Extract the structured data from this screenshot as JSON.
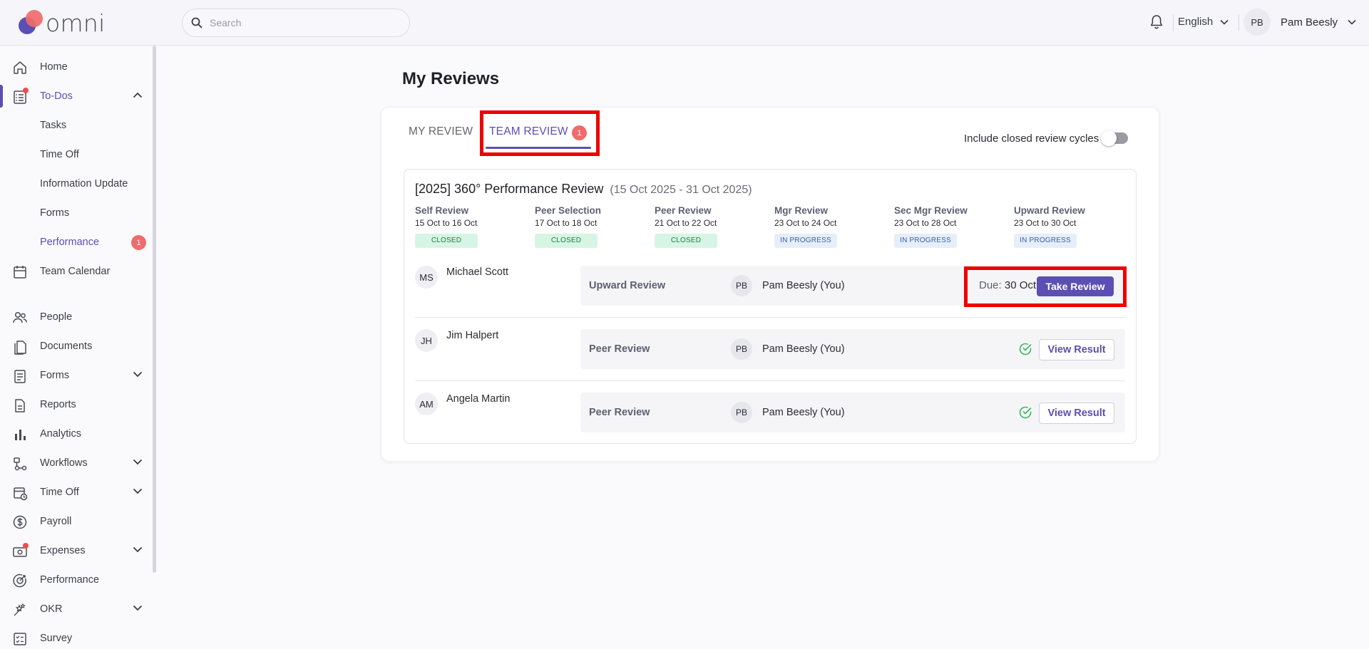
{
  "header": {
    "logo_text": "omni",
    "search_placeholder": "Search",
    "language": "English",
    "user_initials": "PB",
    "user_name": "Pam Beesly"
  },
  "sidebar": {
    "items": [
      {
        "label": "Home",
        "icon": "home-icon"
      },
      {
        "label": "To-Dos",
        "icon": "todo-list-icon"
      },
      {
        "label": "Team Calendar",
        "icon": "calendar-icon"
      },
      {
        "label": "People",
        "icon": "people-icon"
      },
      {
        "label": "Documents",
        "icon": "documents-icon"
      },
      {
        "label": "Forms",
        "icon": "forms-icon"
      },
      {
        "label": "Reports",
        "icon": "report-icon"
      },
      {
        "label": "Analytics",
        "icon": "bar-chart-icon"
      },
      {
        "label": "Workflows",
        "icon": "workflow-icon"
      },
      {
        "label": "Time Off",
        "icon": "time-off-icon"
      },
      {
        "label": "Payroll",
        "icon": "dollar-icon"
      },
      {
        "label": "Expenses",
        "icon": "expenses-icon"
      },
      {
        "label": "Performance",
        "icon": "performance-icon"
      },
      {
        "label": "OKR",
        "icon": "okr-icon"
      },
      {
        "label": "Survey",
        "icon": "survey-icon"
      }
    ],
    "todo_sub": [
      {
        "label": "Tasks"
      },
      {
        "label": "Time Off"
      },
      {
        "label": "Information Update"
      },
      {
        "label": "Forms"
      },
      {
        "label": "Performance",
        "badge": "1"
      }
    ]
  },
  "main": {
    "title": "My Reviews",
    "tabs": [
      {
        "label": "MY REVIEW"
      },
      {
        "label": "TEAM REVIEW",
        "badge": "1"
      }
    ],
    "toggle_label": "Include closed review cycles",
    "toggle_on": false,
    "cycle": {
      "title": "[2025] 360° Performance Review",
      "range": "(15 Oct 2025 - 31 Oct 2025)",
      "stages": [
        {
          "name": "Self Review",
          "dates": "15 Oct to 16 Oct",
          "status": "CLOSED"
        },
        {
          "name": "Peer Selection",
          "dates": "17 Oct to 18 Oct",
          "status": "CLOSED"
        },
        {
          "name": "Peer Review",
          "dates": "21 Oct to 22 Oct",
          "status": "CLOSED"
        },
        {
          "name": "Mgr Review",
          "dates": "23 Oct to 24 Oct",
          "status": "IN PROGRESS"
        },
        {
          "name": "Sec Mgr Review",
          "dates": "23 Oct to 28 Oct",
          "status": "IN PROGRESS"
        },
        {
          "name": "Upward Review",
          "dates": "23 Oct to 30 Oct",
          "status": "IN PROGRESS"
        }
      ],
      "rows": [
        {
          "initials": "MS",
          "name": "Michael Scott",
          "type": "Upward Review",
          "reviewer_initials": "PB",
          "reviewer": "Pam Beesly (You)",
          "due_label": "Due:",
          "due_date": "30 Oct",
          "action": "Take Review"
        },
        {
          "initials": "JH",
          "name": "Jim Halpert",
          "type": "Peer Review",
          "reviewer_initials": "PB",
          "reviewer": "Pam Beesly (You)",
          "action": "View Result"
        },
        {
          "initials": "AM",
          "name": "Angela Martin",
          "type": "Peer Review",
          "reviewer_initials": "PB",
          "reviewer": "Pam Beesly (You)",
          "action": "View Result"
        }
      ]
    }
  },
  "colors": {
    "accent": "#5b4fb3",
    "badge": "#f06b6b",
    "highlight": "#ef0000",
    "closed_bg": "#d7f5e4",
    "progress_bg": "#e6eefa"
  }
}
